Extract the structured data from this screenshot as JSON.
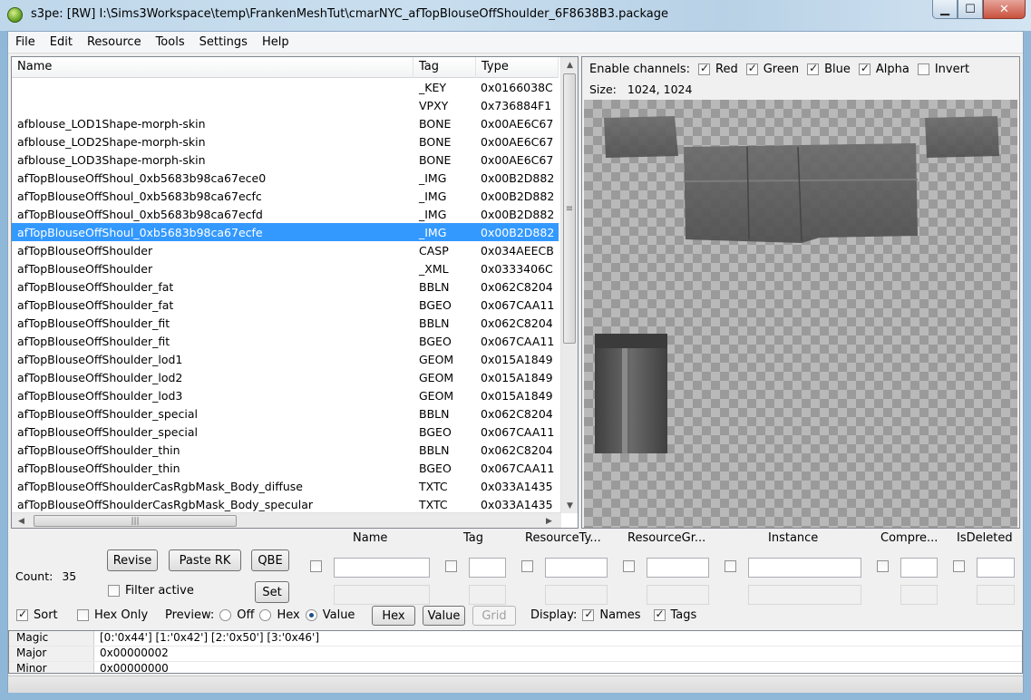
{
  "window": {
    "title": "s3pe: [RW] I:\\Sims3Workspace\\temp\\FrankenMeshTut\\cmarNYC_afTopBlouseOffShoulder_6F8638B3.package",
    "minimize": "▁",
    "maximize": "☐",
    "close": "✕"
  },
  "menu": [
    "File",
    "Edit",
    "Resource",
    "Tools",
    "Settings",
    "Help"
  ],
  "list": {
    "columns": [
      "Name",
      "Tag",
      "Type"
    ],
    "rows": [
      {
        "name": "",
        "tag": "_KEY",
        "type": "0x0166038C"
      },
      {
        "name": "",
        "tag": "VPXY",
        "type": "0x736884F1"
      },
      {
        "name": "afblouse_LOD1Shape-morph-skin",
        "tag": "BONE",
        "type": "0x00AE6C67"
      },
      {
        "name": "afblouse_LOD2Shape-morph-skin",
        "tag": "BONE",
        "type": "0x00AE6C67"
      },
      {
        "name": "afblouse_LOD3Shape-morph-skin",
        "tag": "BONE",
        "type": "0x00AE6C67"
      },
      {
        "name": "afTopBlouseOffShoul_0xb5683b98ca67ece0",
        "tag": "_IMG",
        "type": "0x00B2D882"
      },
      {
        "name": "afTopBlouseOffShoul_0xb5683b98ca67ecfc",
        "tag": "_IMG",
        "type": "0x00B2D882"
      },
      {
        "name": "afTopBlouseOffShoul_0xb5683b98ca67ecfd",
        "tag": "_IMG",
        "type": "0x00B2D882"
      },
      {
        "name": "afTopBlouseOffShoul_0xb5683b98ca67ecfe",
        "tag": "_IMG",
        "type": "0x00B2D882"
      },
      {
        "name": "afTopBlouseOffShoulder",
        "tag": "CASP",
        "type": "0x034AEECB"
      },
      {
        "name": "afTopBlouseOffShoulder",
        "tag": "_XML",
        "type": "0x0333406C"
      },
      {
        "name": "afTopBlouseOffShoulder_fat",
        "tag": "BBLN",
        "type": "0x062C8204"
      },
      {
        "name": "afTopBlouseOffShoulder_fat",
        "tag": "BGEO",
        "type": "0x067CAA11"
      },
      {
        "name": "afTopBlouseOffShoulder_fit",
        "tag": "BBLN",
        "type": "0x062C8204"
      },
      {
        "name": "afTopBlouseOffShoulder_fit",
        "tag": "BGEO",
        "type": "0x067CAA11"
      },
      {
        "name": "afTopBlouseOffShoulder_lod1",
        "tag": "GEOM",
        "type": "0x015A1849"
      },
      {
        "name": "afTopBlouseOffShoulder_lod2",
        "tag": "GEOM",
        "type": "0x015A1849"
      },
      {
        "name": "afTopBlouseOffShoulder_lod3",
        "tag": "GEOM",
        "type": "0x015A1849"
      },
      {
        "name": "afTopBlouseOffShoulder_special",
        "tag": "BBLN",
        "type": "0x062C8204"
      },
      {
        "name": "afTopBlouseOffShoulder_special",
        "tag": "BGEO",
        "type": "0x067CAA11"
      },
      {
        "name": "afTopBlouseOffShoulder_thin",
        "tag": "BBLN",
        "type": "0x062C8204"
      },
      {
        "name": "afTopBlouseOffShoulder_thin",
        "tag": "BGEO",
        "type": "0x067CAA11"
      },
      {
        "name": "afTopBlouseOffShoulderCasRgbMask_Body_diffuse",
        "tag": "TXTC",
        "type": "0x033A1435"
      },
      {
        "name": "afTopBlouseOffShoulderCasRgbMask_Body_specular",
        "tag": "TXTC",
        "type": "0x033A1435"
      }
    ],
    "selected_index": 8,
    "selection_color": "#3399ff"
  },
  "preview": {
    "enable_channels_label": "Enable channels:",
    "channels": [
      {
        "label": "Red",
        "checked": true
      },
      {
        "label": "Green",
        "checked": true
      },
      {
        "label": "Blue",
        "checked": true
      },
      {
        "label": "Alpha",
        "checked": true
      },
      {
        "label": "Invert",
        "checked": false
      }
    ],
    "size_label": "Size:",
    "size_value": "1024, 1024"
  },
  "controls": {
    "count_label": "Count:",
    "count_value": "35",
    "revise": "Revise",
    "paste_rk": "Paste RK",
    "qbe": "QBE",
    "set": "Set",
    "filter_active": "Filter active",
    "filter_columns": [
      "Name",
      "Tag",
      "ResourceTy...",
      "ResourceGr...",
      "Instance",
      "Compre...",
      "IsDeleted"
    ],
    "sort": "Sort",
    "hex_only": "Hex Only",
    "preview_label": "Preview:",
    "preview_off": "Off",
    "preview_hex": "Hex",
    "preview_value": "Value",
    "hex_btn": "Hex",
    "value_btn": "Value",
    "grid_btn": "Grid",
    "display_label": "Display:",
    "names": "Names",
    "tags": "Tags"
  },
  "properties": [
    {
      "key": "Magic",
      "value": "[0:'0x44'] [1:'0x42'] [2:'0x50'] [3:'0x46']"
    },
    {
      "key": "Major",
      "value": "0x00000002"
    },
    {
      "key": "Minor",
      "value": "0x00000000"
    }
  ]
}
